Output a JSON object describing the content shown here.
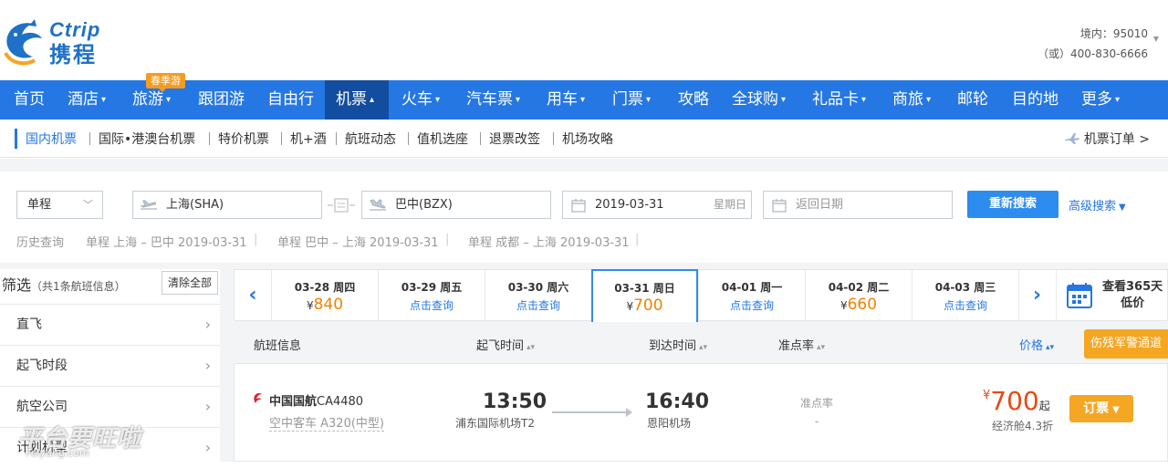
{
  "brand": {
    "en": "Ctrip",
    "cn": "携程"
  },
  "hotline": {
    "domestic": "境内：95010",
    "alt": "（或）400-830-6666"
  },
  "spring_badge": "春季游",
  "nav": [
    {
      "label": "首页",
      "caret": false
    },
    {
      "label": "酒店",
      "caret": true
    },
    {
      "label": "旅游",
      "caret": true
    },
    {
      "label": "跟团游",
      "caret": false
    },
    {
      "label": "自由行",
      "caret": false
    },
    {
      "label": "机票",
      "caret": true,
      "active": true
    },
    {
      "label": "火车",
      "caret": true
    },
    {
      "label": "汽车票",
      "caret": true
    },
    {
      "label": "用车",
      "caret": true
    },
    {
      "label": "门票",
      "caret": true
    },
    {
      "label": "攻略",
      "caret": false
    },
    {
      "label": "全球购",
      "caret": true
    },
    {
      "label": "礼品卡",
      "caret": true
    },
    {
      "label": "商旅",
      "caret": true
    },
    {
      "label": "邮轮",
      "caret": false
    },
    {
      "label": "目的地",
      "caret": false
    },
    {
      "label": "更多",
      "caret": true
    }
  ],
  "subnav": [
    "国内机票",
    "国际•港澳台机票",
    "特价机票",
    "机+酒",
    "航班动态",
    "值机选座",
    "退票改签",
    "机场攻略"
  ],
  "orders_label": "机票订单 >",
  "search": {
    "trip_type": "单程",
    "from": "上海(SHA)",
    "to": "巴中(BZX)",
    "depart_date": "2019-03-31",
    "depart_weekday": "星期日",
    "return_placeholder": "返回日期",
    "search_button": "重新搜索",
    "advanced": "高级搜索"
  },
  "history": {
    "label": "历史查询",
    "items": [
      "单程 上海 – 巴中 2019-03-31",
      "单程 巴中 – 上海 2019-03-31",
      "单程 成都 – 上海 2019-03-31"
    ]
  },
  "filter": {
    "title": "筛选",
    "count": "（共1条航班信息）",
    "clear": "清除全部",
    "rows": [
      "直飞",
      "起飞时段",
      "航空公司",
      "计划机型"
    ]
  },
  "dates": [
    {
      "date": "03-28 周四",
      "price": "840",
      "query": ""
    },
    {
      "date": "03-29 周五",
      "price": "",
      "query": "点击查询"
    },
    {
      "date": "03-30 周六",
      "price": "",
      "query": "点击查询"
    },
    {
      "date": "03-31 周日",
      "price": "700",
      "query": "",
      "active": true
    },
    {
      "date": "04-01 周一",
      "price": "",
      "query": "点击查询"
    },
    {
      "date": "04-02 周二",
      "price": "660",
      "query": ""
    },
    {
      "date": "04-03 周三",
      "price": "",
      "query": "点击查询"
    }
  ],
  "currency": "¥",
  "calendar": {
    "line1": "查看365天",
    "line2": "低价"
  },
  "table_head": {
    "info": "航班信息",
    "depart": "起飞时间",
    "arrive": "到达时间",
    "ontime": "准点率",
    "price": "价格",
    "special": "伤残军警通道"
  },
  "flight": {
    "airline": "中国国航",
    "number": "CA4480",
    "aircraft": "空中客车 A320(中型)",
    "depart_time": "13:50",
    "depart_airport": "浦东国际机场T2",
    "arrive_time": "16:40",
    "arrive_airport": "恩阳机场",
    "ontime_label": "准点率",
    "ontime_value": "-",
    "price": "700",
    "price_suffix": "起",
    "cabin": "经济舱4.3折",
    "book": "订票"
  },
  "watermark": {
    "line1": "平台要旺啦",
    "line2": "Feiyang.com"
  },
  "colors": {
    "nav": "#2577e3",
    "nav_active": "#124d9f",
    "accent": "#f5a623",
    "price": "#e64b13"
  }
}
